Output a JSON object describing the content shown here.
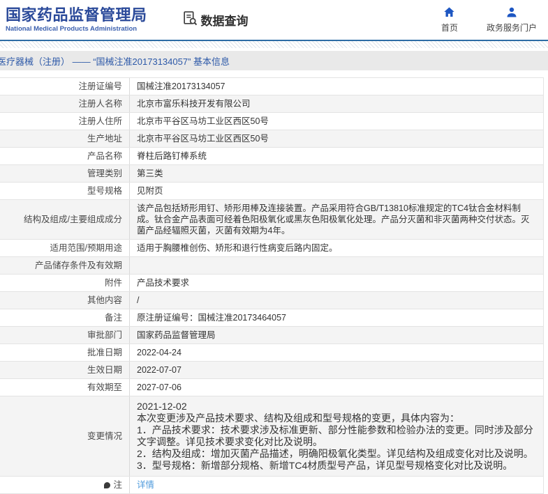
{
  "header": {
    "title": "国家药品监督管理局",
    "subtitle": "National Medical Products Administration",
    "section": "数据查询",
    "nav": [
      {
        "label": "首页",
        "icon": "home-icon"
      },
      {
        "label": "政务服务门户",
        "icon": "user-icon"
      }
    ]
  },
  "breadcrumb": "医疗器械（注册） —— “国械注准20173134057” 基本信息",
  "colors": {
    "brand_blue": "#2b4a9a",
    "nav_icon_blue": "#1d56c2",
    "divider_blue": "#2d6ca5",
    "breadcrumb_bg": "#e9e9e9",
    "row_alt_bg": "#f4f4f4",
    "link_blue": "#4f9bdc"
  },
  "table": {
    "rows": [
      {
        "label": "注册证编号",
        "value": "国械注准20173134057"
      },
      {
        "label": "注册人名称",
        "value": "北京市富乐科技开发有限公司"
      },
      {
        "label": "注册人住所",
        "value": "北京市平谷区马坊工业区西区50号"
      },
      {
        "label": "生产地址",
        "value": "北京市平谷区马坊工业区西区50号"
      },
      {
        "label": "产品名称",
        "value": "脊柱后路钉棒系统"
      },
      {
        "label": "管理类别",
        "value": "第三类"
      },
      {
        "label": "型号规格",
        "value": "见附页"
      },
      {
        "label": "结构及组成/主要组成成分",
        "value": "该产品包括矫形用钉、矫形用棒及连接装置。产品采用符合GB/T13810标准规定的TC4钛合金材料制成。钛合金产品表面可经着色阳极氧化或黑灰色阳极氧化处理。产品分灭菌和非灭菌两种交付状态。灭菌产品经辐照灭菌，灭菌有效期为4年。"
      },
      {
        "label": "适用范围/预期用途",
        "value": "适用于胸腰椎创伤、矫形和退行性病变后路内固定。"
      },
      {
        "label": "产品储存条件及有效期",
        "value": ""
      },
      {
        "label": "附件",
        "value": "产品技术要求"
      },
      {
        "label": "其他内容",
        "value": "/"
      },
      {
        "label": "备注",
        "value": "原注册证编号：国械注准20173464057"
      },
      {
        "label": "审批部门",
        "value": "国家药品监督管理局"
      },
      {
        "label": "批准日期",
        "value": "2022-04-24"
      },
      {
        "label": "生效日期",
        "value": "2022-07-07"
      },
      {
        "label": "有效期至",
        "value": "2027-07-06"
      },
      {
        "label": "变更情况",
        "large": true,
        "lines": [
          "2021-12-02",
          "本次变更涉及产品技术要求、结构及组成和型号规格的变更，具体内容为：",
          "1．产品技术要求：技术要求涉及标准更新、部分性能参数和检验办法的变更。同时涉及部分文字调整。详见技术要求变化对比及说明。",
          "2．结构及组成：增加灭菌产品描述，明确阳极氧化类型。详见结构及组成变化对比及说明。",
          "3．型号规格：新增部分规格、新增TC4材质型号产品，详见型号规格变化对比及说明。"
        ]
      },
      {
        "label": "注",
        "note_icon": true,
        "link": "详情"
      }
    ]
  }
}
